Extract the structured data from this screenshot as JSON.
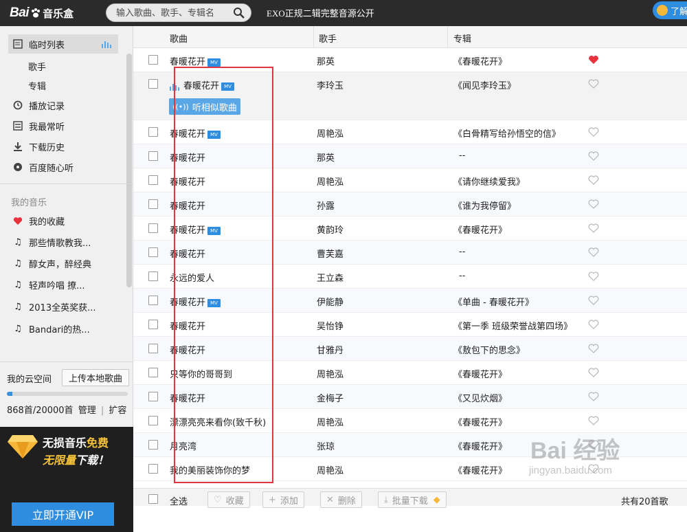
{
  "header": {
    "logo_text": "Bai",
    "logo_suffix": "音乐盒",
    "search_placeholder": "输入歌曲、歌手、专辑名",
    "news": "EXO正规二辑完整音源公开",
    "vip_label": "了解"
  },
  "sidebar": {
    "playlist": "临时列表",
    "sub_singer": "歌手",
    "sub_album": "专辑",
    "history": "播放记录",
    "frequent": "我最常听",
    "downloads": "下载历史",
    "radio": "百度随心听",
    "my_music_head": "我的音乐",
    "favorites": "我的收藏",
    "lists": [
      "那些情歌教我...",
      "醇女声，醉经典",
      "轻声吟唱 撩...",
      "2013全英奖获...",
      "Bandari的热..."
    ],
    "cloud_label": "我的云空间",
    "upload_label": "上传本地歌曲",
    "quota_used": "868首/20000首",
    "quota_fraction": 0.0434,
    "manage": "管理",
    "expand": "扩容",
    "promo_line1_a": "无损音乐",
    "promo_line1_b": "免费",
    "promo_line2_a": "无限量",
    "promo_line2_b": "下载！",
    "vip_button": "立即开通VIP"
  },
  "table": {
    "col_song": "歌曲",
    "col_artist": "歌手",
    "col_album": "专辑",
    "similar_button": "听相似歌曲",
    "rows": [
      {
        "title": "春暖花开",
        "mv": true,
        "artist": "那英",
        "album": "《春暖花开》",
        "fav": true
      },
      {
        "title": "春暖花开",
        "mv": true,
        "artist": "李玲玉",
        "album": "《闻见李玲玉》",
        "fav": false
      },
      {
        "title": "春暖花开",
        "mv": true,
        "artist": "周艳泓",
        "album": "《白骨精写给孙悟空的信》",
        "fav": false
      },
      {
        "title": "春暖花开",
        "mv": false,
        "artist": "那英",
        "album": "--",
        "fav": false
      },
      {
        "title": "春暖花开",
        "mv": false,
        "artist": "周艳泓",
        "album": "《请你继续爱我》",
        "fav": false
      },
      {
        "title": "春暖花开",
        "mv": false,
        "artist": "孙露",
        "album": "《谁为我停留》",
        "fav": false
      },
      {
        "title": "春暖花开",
        "mv": true,
        "artist": "黄韵玲",
        "album": "《春暖花开》",
        "fav": false
      },
      {
        "title": "春暖花开",
        "mv": false,
        "artist": "曹芙嘉",
        "album": "--",
        "fav": false
      },
      {
        "title": "永远的爱人",
        "mv": false,
        "artist": "王立森",
        "album": "--",
        "fav": false
      },
      {
        "title": "春暖花开",
        "mv": true,
        "artist": "伊能静",
        "album": "《单曲 - 春暖花开》",
        "fav": false
      },
      {
        "title": "春暖花开",
        "mv": false,
        "artist": "吴怡铮",
        "album": "《第一季 班级荣誉战第四场》",
        "fav": false
      },
      {
        "title": "春暖花开",
        "mv": false,
        "artist": "甘雅丹",
        "album": "《敖包下的思念》",
        "fav": false
      },
      {
        "title": "只等你的哥哥到",
        "mv": false,
        "artist": "周艳泓",
        "album": "《春暖花开》",
        "fav": false
      },
      {
        "title": "春暖花开",
        "mv": false,
        "artist": "金梅子",
        "album": "《又见炊烟》",
        "fav": false
      },
      {
        "title": "漂漂亮亮来看你(致千秋)",
        "mv": false,
        "artist": "周艳泓",
        "album": "《春暖花开》",
        "fav": false
      },
      {
        "title": "月亮湾",
        "mv": false,
        "artist": "张琼",
        "album": "《春暖花开》",
        "fav": false
      },
      {
        "title": "我的美丽装饰你的梦",
        "mv": false,
        "artist": "周艳泓",
        "album": "《春暖花开》",
        "fav": false
      }
    ]
  },
  "footer": {
    "select_all": "全选",
    "favorite": "收藏",
    "add": "添加",
    "delete": "删除",
    "batch_download": "批量下载",
    "total": "共有20首歌"
  },
  "watermark": {
    "brand": "Bai  经验",
    "url": "jingyan.baidu.com"
  },
  "colors": {
    "accent": "#2f8ddf",
    "highlight": "#e3333f",
    "fav": "#e8333f"
  }
}
